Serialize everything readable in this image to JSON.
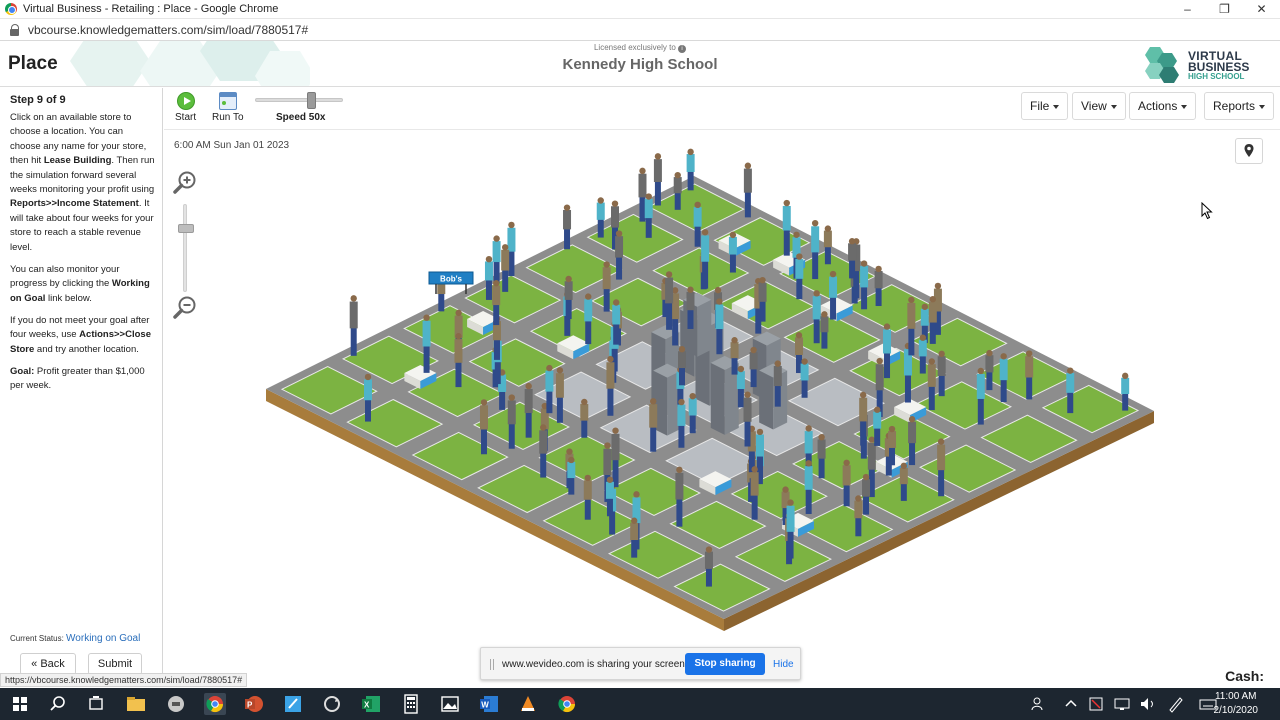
{
  "browser": {
    "title": "Virtual Business - Retailing : Place - Google Chrome",
    "url": "vbcourse.knowledgematters.com/sim/load/7880517#",
    "window_controls": [
      "minimize-icon",
      "restore-icon",
      "close-icon"
    ]
  },
  "header": {
    "page_title": "Place",
    "licensed_text": "Licensed exclusively to",
    "school": "Kennedy High School",
    "logo": {
      "line1": "VIRTUAL",
      "line2": "BUSINESS",
      "line3": "HIGH SCHOOL"
    }
  },
  "left_panel": {
    "step": "Step 9 of 9",
    "p1": {
      "a": "Click on an available store to choose a location. You can choose any name for your store, then hit ",
      "b": "Lease Building",
      "c": ". Then run the simulation forward several weeks monitoring your profit using ",
      "d": "Reports>>Income Statement",
      "e": ". It will take about four weeks for your store to reach a stable revenue level."
    },
    "p2": {
      "a": "You can also monitor your progress by clicking the ",
      "b": "Working on Goal",
      "c": " link below."
    },
    "p3": {
      "a": "If you do not meet your goal after four weeks, use ",
      "b": "Actions>>Close Store",
      "c": " and try another location."
    },
    "p4": {
      "b": "Goal:",
      "a": " Profit greater than $1,000 per week."
    },
    "status_label": "Current Status:",
    "status_value": "Working on Goal",
    "back": "« Back",
    "submit": "Submit"
  },
  "toolbar": {
    "start": "Start",
    "run_to": "Run To",
    "speed": "Speed 50x",
    "speed_value": 50,
    "menus": [
      "File",
      "View",
      "Actions",
      "Reports"
    ]
  },
  "stage": {
    "timestamp": "6:00 AM Sun Jan 01 2023",
    "store_sign": "Bob's"
  },
  "share_bar": {
    "message": "www.wevideo.com is sharing your screen.",
    "stop": "Stop sharing",
    "hide": "Hide"
  },
  "status_url": "https://vbcourse.knowledgematters.com/sim/load/7880517#",
  "cash_label": "Cash:",
  "taskbar": {
    "time": "11:00 AM",
    "date": "2/10/2020",
    "apps": [
      "windows-start-icon",
      "search-icon",
      "task-view-icon",
      "file-explorer-icon",
      "chrome-icon",
      "powerpoint-icon",
      "notepad-icon",
      "excel-icon",
      "calculator-icon",
      "photos-icon",
      "word-icon",
      "vlc-icon"
    ]
  },
  "colors": {
    "accent_blue": "#1a73e8",
    "start_green": "#5bbd3c",
    "grass": "#7cb342",
    "road": "#8d8d8d",
    "ground_edge": "#a87c3c",
    "taskbar": "#1d2630"
  }
}
